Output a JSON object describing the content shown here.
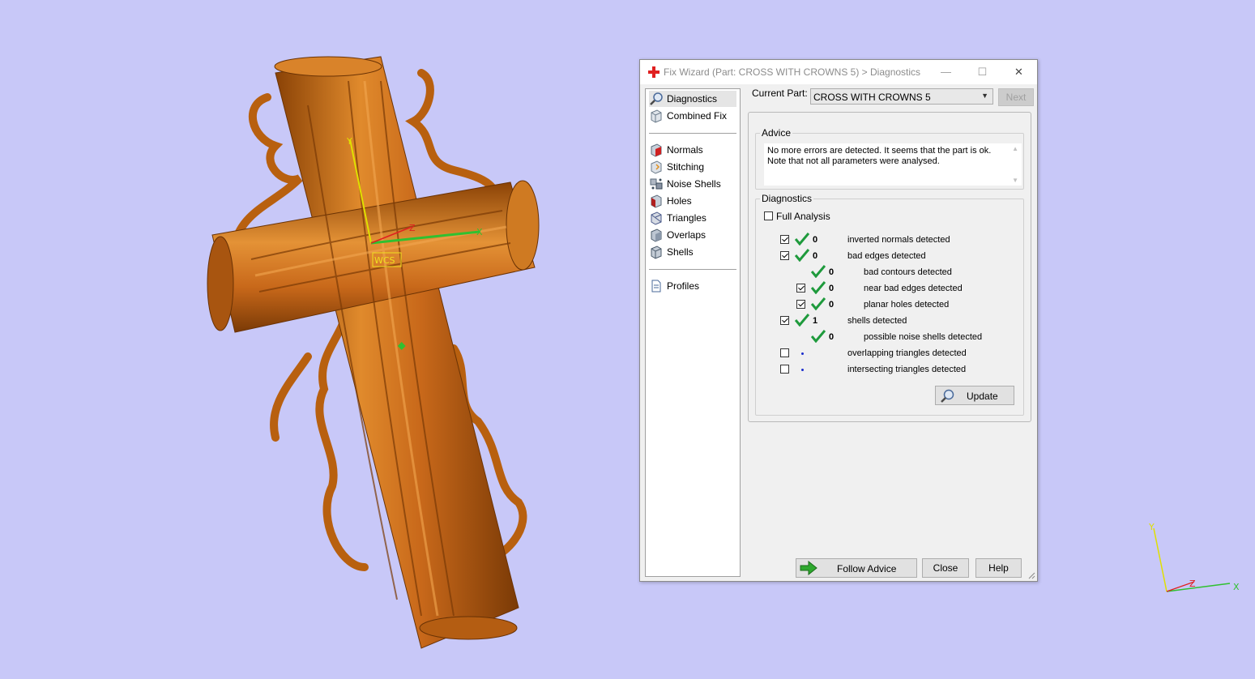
{
  "viewport": {
    "background": "#c8c8f8",
    "model_color": "#c86a16",
    "wcs_label": "WCS",
    "axis_labels": {
      "x": "X",
      "y": "Y",
      "z": "Z"
    }
  },
  "dialog": {
    "title": "Fix Wizard (Part: CROSS WITH CROWNS 5) > Diagnostics",
    "title_icon": "red-cross-icon",
    "window_buttons": {
      "minimize": "—",
      "maximize": "☐",
      "close": "✕"
    },
    "nav": {
      "top": [
        {
          "label": "Diagnostics",
          "icon": "magnifier-icon",
          "selected": true
        },
        {
          "label": "Combined Fix",
          "icon": "cube-icon"
        }
      ],
      "tools": [
        {
          "label": "Normals",
          "icon": "normals-cube-icon"
        },
        {
          "label": "Stitching",
          "icon": "stitching-cube-icon"
        },
        {
          "label": "Noise Shells",
          "icon": "noise-shells-icon"
        },
        {
          "label": "Holes",
          "icon": "holes-cube-icon"
        },
        {
          "label": "Triangles",
          "icon": "triangles-cube-icon"
        },
        {
          "label": "Overlaps",
          "icon": "overlaps-cube-icon"
        },
        {
          "label": "Shells",
          "icon": "shells-cube-icon"
        }
      ],
      "bottom": [
        {
          "label": "Profiles",
          "icon": "document-icon"
        }
      ]
    },
    "current_part_label": "Current Part:",
    "current_part_value": "CROSS WITH CROWNS 5",
    "next_button": "Next",
    "advice": {
      "title": "Advice",
      "text": "No more errors are detected. It seems that the part is ok. Note that not all parameters were analysed."
    },
    "diagnostics": {
      "title": "Diagnostics",
      "full_analysis_label": "Full Analysis",
      "full_analysis_checked": false,
      "rows": [
        {
          "checkbox": true,
          "checked": true,
          "status": "ok",
          "count": "0",
          "label": "inverted normals detected",
          "indent": 0
        },
        {
          "checkbox": true,
          "checked": true,
          "status": "ok",
          "count": "0",
          "label": "bad edges detected",
          "indent": 0
        },
        {
          "checkbox": false,
          "checked": false,
          "status": "ok",
          "count": "0",
          "label": "bad contours detected",
          "indent": 1
        },
        {
          "checkbox": true,
          "checked": true,
          "status": "ok",
          "count": "0",
          "label": "near bad edges detected",
          "indent": 1
        },
        {
          "checkbox": true,
          "checked": true,
          "status": "ok",
          "count": "0",
          "label": "planar holes detected",
          "indent": 1
        },
        {
          "checkbox": true,
          "checked": true,
          "status": "ok",
          "count": "1",
          "label": "shells detected",
          "indent": 0
        },
        {
          "checkbox": false,
          "checked": false,
          "status": "ok",
          "count": "0",
          "label": "possible noise shells detected",
          "indent": 1
        },
        {
          "checkbox": true,
          "checked": false,
          "status": "none",
          "count": "",
          "label": "overlapping triangles detected",
          "indent": 0
        },
        {
          "checkbox": true,
          "checked": false,
          "status": "none",
          "count": "",
          "label": "intersecting triangles detected",
          "indent": 0
        }
      ],
      "update_button": "Update",
      "update_icon": "magnifier-icon"
    },
    "buttons": {
      "follow_advice": "Follow Advice",
      "follow_advice_icon": "green-arrow-icon",
      "close": "Close",
      "help": "Help"
    },
    "colors": {
      "ok_tick": "#1e9a3c",
      "not_run_dot": "#1a2ccc",
      "title_icon": "#e02020"
    }
  }
}
